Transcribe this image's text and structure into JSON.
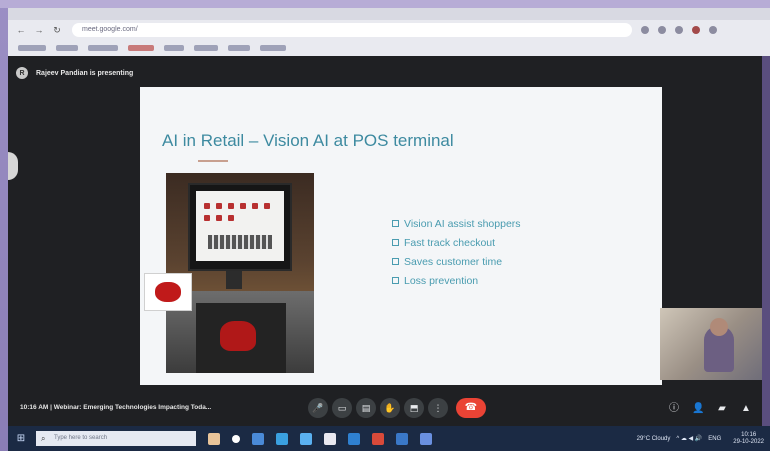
{
  "browser": {
    "url": "meet.google.com/",
    "bookmarks_count_hint": "",
    "icons": [
      "back-arrow-icon",
      "forward-arrow-icon",
      "reload-icon",
      "extension-icon",
      "profile-icon"
    ]
  },
  "meet": {
    "presenting_label": "Rajeev Pandian is presenting",
    "presenter_initial": "R",
    "meeting_time": "10:16 AM",
    "meeting_separator": "|",
    "meeting_title": "Webinar: Emerging Technologies Impacting Toda...",
    "controls": {
      "mic": "🎤",
      "camera": "▭",
      "captions": "▤",
      "raise_hand": "✋",
      "present": "⬒",
      "more": "⋮",
      "end_call": "☎"
    },
    "right_controls": {
      "info": "ⓘ",
      "people": "👤",
      "chat": "▰",
      "activities": "▲"
    }
  },
  "slide": {
    "title": "AI in Retail – Vision AI at POS terminal",
    "bullets": [
      "Vision AI assist shoppers",
      "Fast track checkout",
      "Saves customer time",
      "Loss prevention"
    ]
  },
  "taskbar": {
    "start_icon": "⊞",
    "search_placeholder": "Type here to search",
    "search_icon": "⌕",
    "weather": "29°C Cloudy",
    "tray_icons": "^ ☁ ◀ 🔊",
    "lang": "ENG",
    "time": "10:16",
    "date": "29-10-2022"
  },
  "colors": {
    "slide_title": "#3d8aa0",
    "bullet_text": "#4a9cb0",
    "end_call": "#ea4335",
    "meet_bg": "#1f2023",
    "taskbar_bg": "#1b2a44"
  }
}
